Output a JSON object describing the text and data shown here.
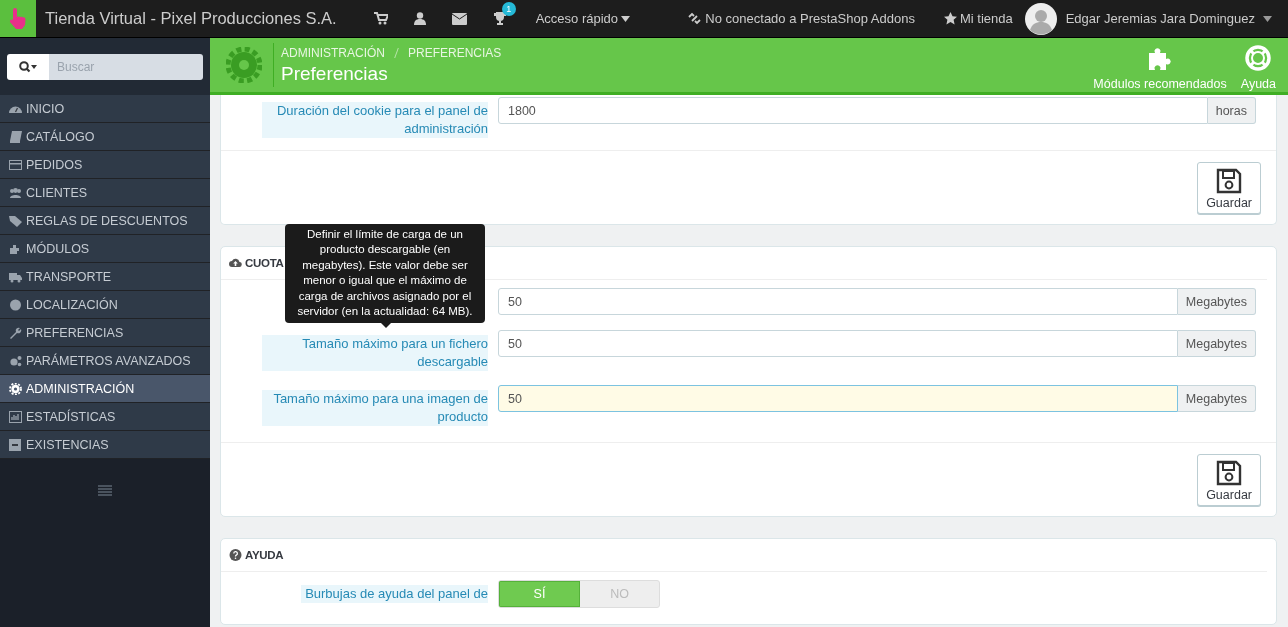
{
  "topbar": {
    "shop_name": "Tienda Virtual - Pixel Producciones S.A.",
    "notification_badge": "1",
    "quick_access": "Acceso rápido",
    "addons_status": "No conectado a PrestaShop Addons",
    "my_shop": "Mi tienda",
    "user_name": "Edgar Jeremias Jara Dominguez"
  },
  "sidebar": {
    "search_placeholder": "Buscar",
    "items": [
      {
        "label": "INICIO",
        "selected": false
      },
      {
        "label": "CATÁLOGO",
        "selected": false
      },
      {
        "label": "PEDIDOS",
        "selected": false
      },
      {
        "label": "CLIENTES",
        "selected": false
      },
      {
        "label": "REGLAS DE DESCUENTOS",
        "selected": false
      },
      {
        "label": "MÓDULOS",
        "selected": false
      },
      {
        "label": "TRANSPORTE",
        "selected": false
      },
      {
        "label": "LOCALIZACIÓN",
        "selected": false
      },
      {
        "label": "PREFERENCIAS",
        "selected": false
      },
      {
        "label": "PARÁMETROS AVANZADOS",
        "selected": false
      },
      {
        "label": "ADMINISTRACIÓN",
        "selected": true
      },
      {
        "label": "ESTADÍSTICAS",
        "selected": false
      },
      {
        "label": "EXISTENCIAS",
        "selected": false
      }
    ]
  },
  "header": {
    "breadcrumb": [
      "ADMINISTRACIÓN",
      "PREFERENCIAS"
    ],
    "title": "Preferencias",
    "actions": [
      {
        "label": "Módulos recomendados"
      },
      {
        "label": "Ayuda"
      }
    ]
  },
  "panels": [
    {
      "fields": [
        {
          "kind": "input",
          "label": "Duración del cookie para el panel de administración",
          "value": "1800",
          "addon": "horas",
          "focused": false
        }
      ],
      "save_label": "Guardar"
    },
    {
      "title": "CUOTA",
      "fields": [
        {
          "kind": "input",
          "value": "50",
          "addon": "Megabytes",
          "focused": false
        },
        {
          "kind": "input",
          "label": "Tamaño máximo para un fichero descargable",
          "value": "50",
          "addon": "Megabytes",
          "focused": false
        },
        {
          "kind": "input",
          "label": "Tamaño máximo para una imagen de producto",
          "value": "50",
          "addon": "Megabytes",
          "focused": true
        }
      ],
      "save_label": "Guardar"
    },
    {
      "title": "AYUDA",
      "fields": [
        {
          "kind": "switch",
          "label": "Burbujas de ayuda del panel de",
          "options": [
            {
              "label": "SÍ",
              "selected": true
            },
            {
              "label": "NO",
              "selected": false
            }
          ]
        }
      ]
    }
  ],
  "tooltip": {
    "text": "Definir el límite de carga de un producto descargable (en megabytes). Este valor debe ser menor o igual que el máximo de carga de archivos asignado por el servidor (en la actualidad: 64 MB)."
  }
}
